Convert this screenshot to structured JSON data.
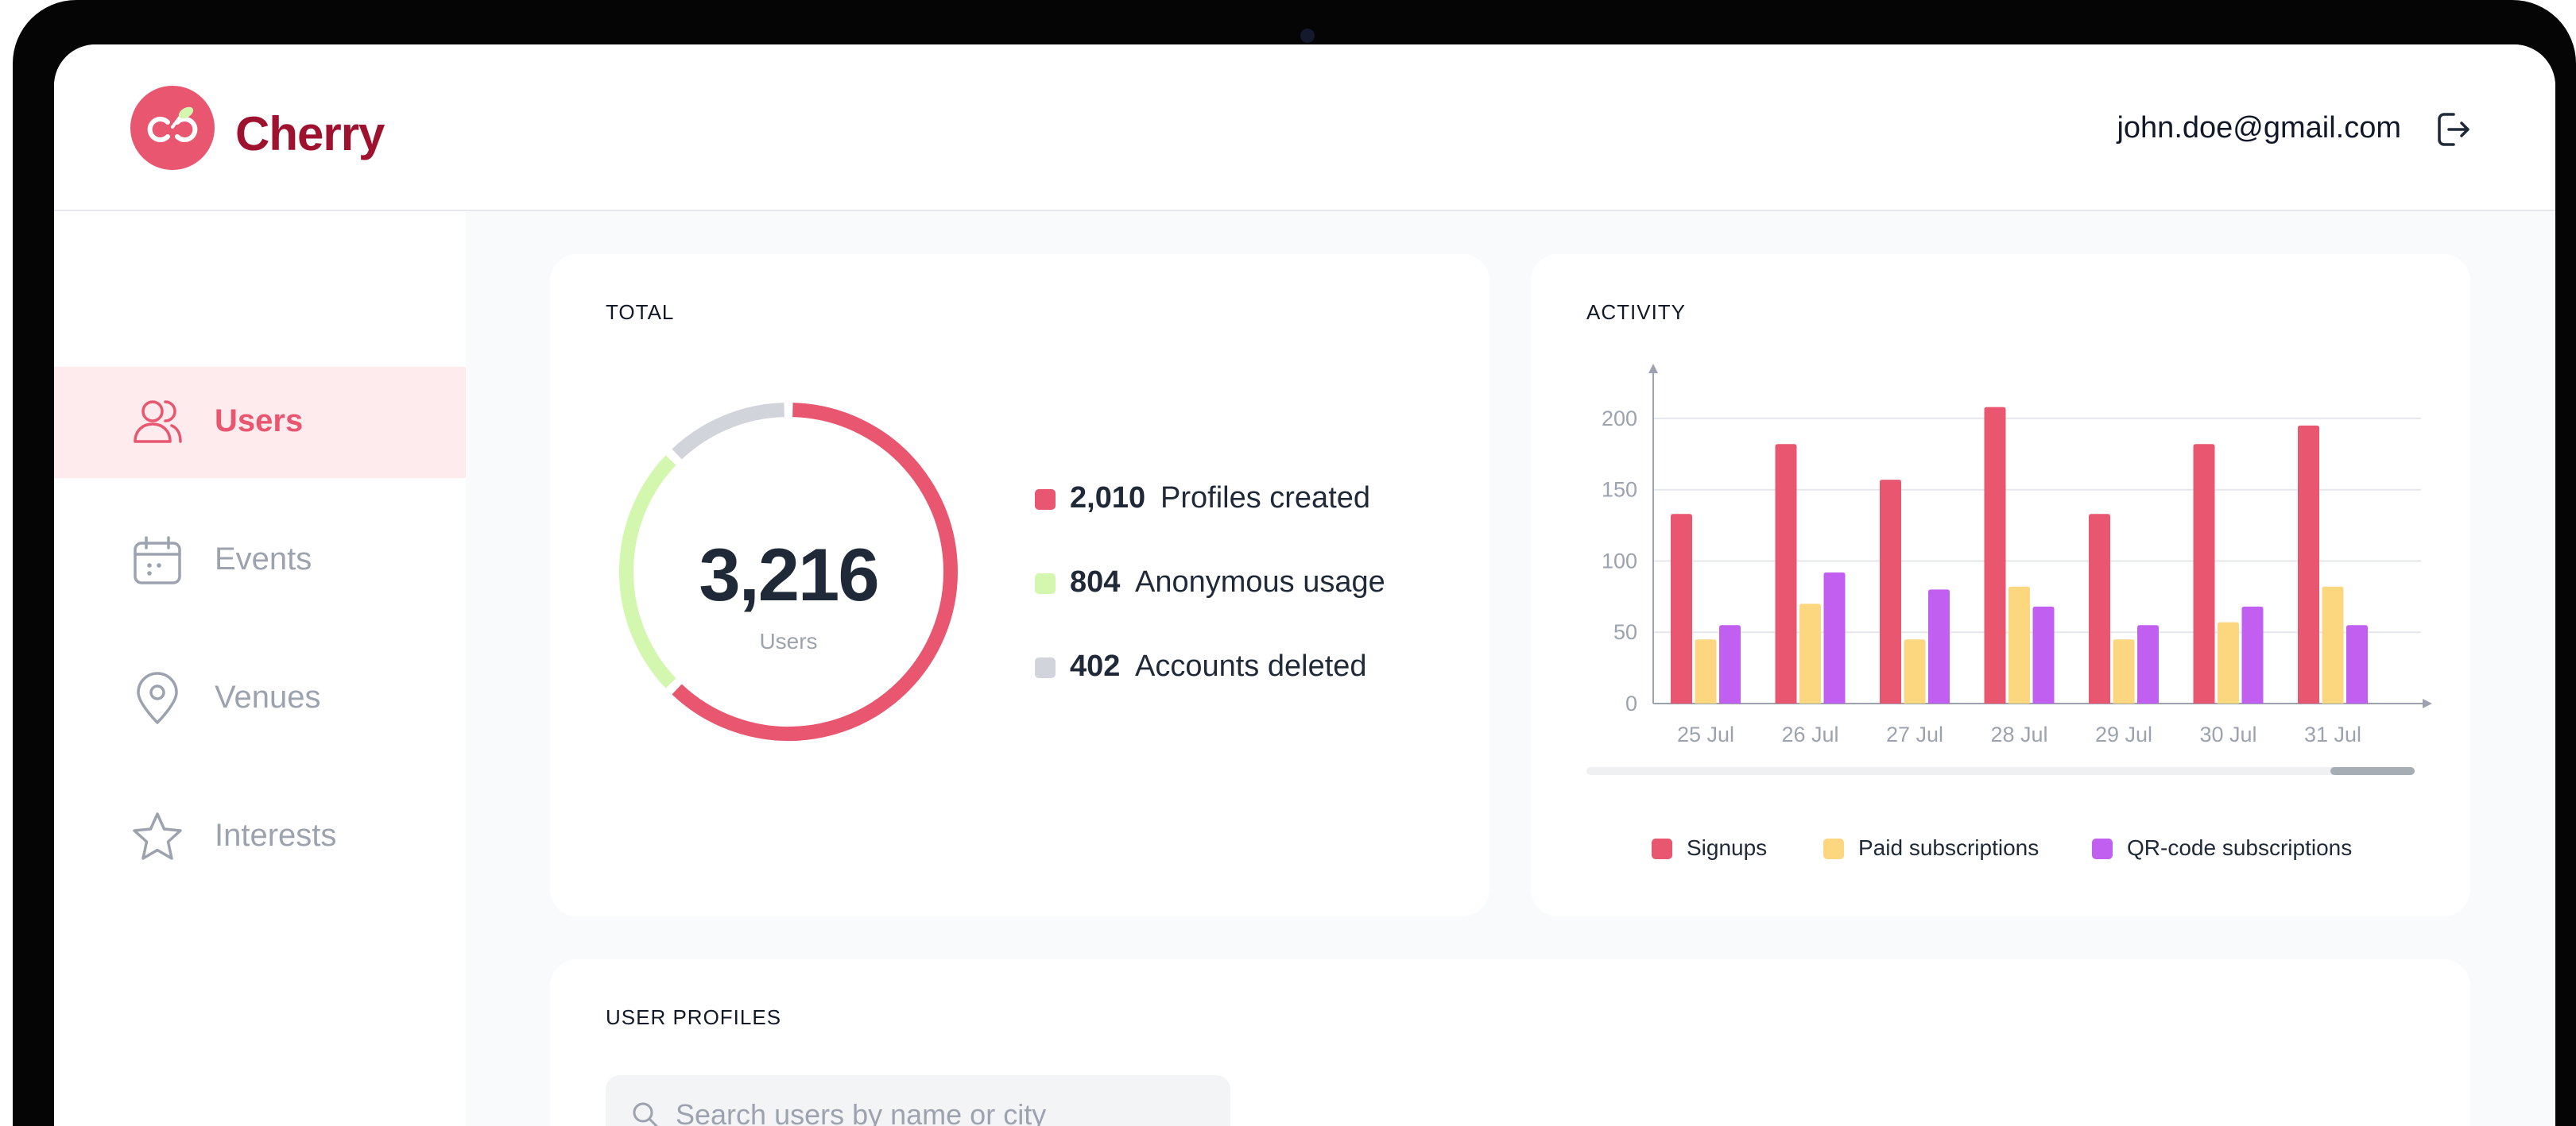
{
  "app": {
    "name": "Cherry",
    "user_email": "john.doe@gmail.com"
  },
  "colors": {
    "brand": "#e8566f",
    "brand_dark": "#9e1230",
    "green": "#d4f7b0",
    "gray": "#d1d5db",
    "yellow": "#fdd680",
    "purple": "#c15ff0"
  },
  "sidebar": {
    "items": [
      {
        "label": "Users",
        "icon": "users-icon",
        "active": true
      },
      {
        "label": "Events",
        "icon": "calendar-icon",
        "active": false
      },
      {
        "label": "Venues",
        "icon": "map-pin-icon",
        "active": false
      },
      {
        "label": "Interests",
        "icon": "star-icon",
        "active": false
      }
    ]
  },
  "total_card": {
    "title": "TOTAL",
    "total_value": "3,216",
    "total_label": "Users",
    "legend": [
      {
        "value": "2,010",
        "label": "Profiles created",
        "color": "#e8566f"
      },
      {
        "value": "804",
        "label": "Anonymous usage",
        "color": "#d4f7b0"
      },
      {
        "value": "402",
        "label": "Accounts deleted",
        "color": "#d1d5db"
      }
    ]
  },
  "activity_card": {
    "title": "ACTIVITY"
  },
  "user_profiles": {
    "title": "USER PROFILES",
    "search_placeholder": "Search users by name or city"
  },
  "chart_data": [
    {
      "type": "pie",
      "variant": "donut",
      "labels": [
        "Profiles created",
        "Anonymous usage",
        "Accounts deleted"
      ],
      "values": [
        2010,
        804,
        402
      ],
      "colors": [
        "#e8566f",
        "#d4f7b0",
        "#d1d5db"
      ],
      "center_value": "3,216",
      "center_label": "Users"
    },
    {
      "type": "bar",
      "title": "ACTIVITY",
      "categories": [
        "25 Jul",
        "26 Jul",
        "27 Jul",
        "28 Jul",
        "29 Jul",
        "30 Jul",
        "31 Jul"
      ],
      "series": [
        {
          "name": "Signups",
          "color": "#e8566f",
          "values": [
            133,
            182,
            157,
            208,
            133,
            182,
            195
          ]
        },
        {
          "name": "Paid subscriptions",
          "color": "#fdd680",
          "values": [
            45,
            70,
            45,
            82,
            45,
            57,
            82
          ]
        },
        {
          "name": "QR-code subscriptions",
          "color": "#c15ff0",
          "values": [
            55,
            92,
            80,
            68,
            55,
            68,
            55
          ]
        }
      ],
      "yticks": [
        0,
        50,
        100,
        150,
        200
      ],
      "ylim": [
        0,
        215
      ],
      "grid": true,
      "legend": "bottom"
    }
  ]
}
